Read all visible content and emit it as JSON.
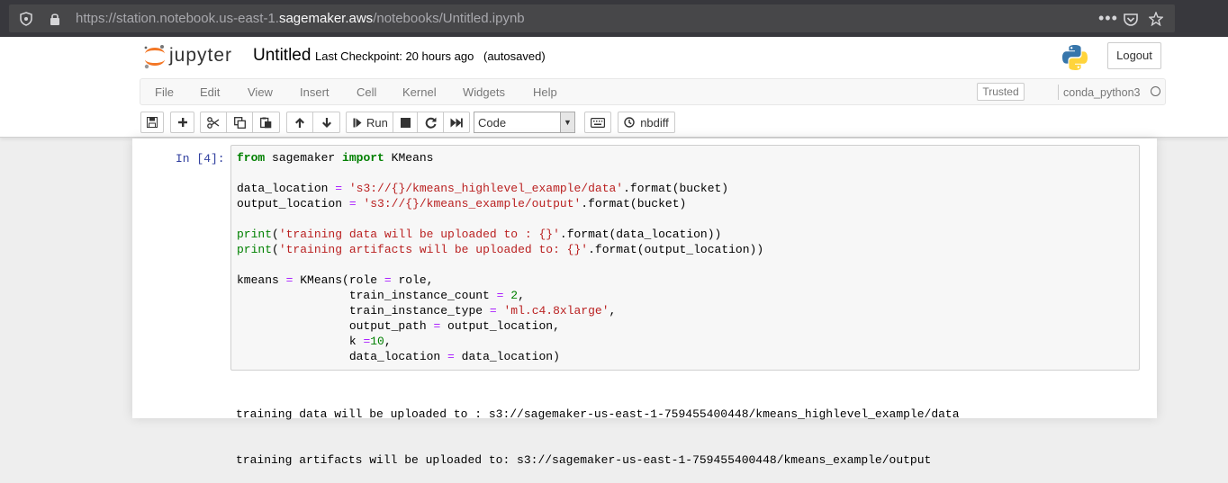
{
  "browser": {
    "url_prefix": "https://station.notebook.us-east-1.",
    "url_domain": "sagemaker.aws",
    "url_path": "/notebooks/Untitled.ipynb",
    "icons": [
      "shield-icon",
      "lock-icon",
      "more-icon",
      "pocket-icon",
      "star-icon"
    ]
  },
  "header": {
    "logo_text": "jupyter",
    "notebook_title": "Untitled",
    "checkpoint": "Last Checkpoint: 20 hours ago",
    "autosave": "(autosaved)",
    "logout_label": "Logout"
  },
  "menu": {
    "items": [
      "File",
      "Edit",
      "View",
      "Insert",
      "Cell",
      "Kernel",
      "Widgets",
      "Help"
    ],
    "trusted": "Trusted",
    "kernel": "conda_python3"
  },
  "toolbar": {
    "run_label": "Run",
    "cell_type": "Code",
    "nbdiff_label": "nbdiff"
  },
  "cell": {
    "prompt": "In [4]:",
    "code_lines": [
      [
        [
          "kw",
          "from"
        ],
        [
          "",
          " sagemaker "
        ],
        [
          "kw",
          "import"
        ],
        [
          "",
          " KMeans"
        ]
      ],
      [],
      [
        [
          "",
          "data_location "
        ],
        [
          "op",
          "="
        ],
        [
          "",
          " "
        ],
        [
          "str",
          "'s3://{}/kmeans_highlevel_example/data'"
        ],
        [
          "",
          ".format(bucket)"
        ]
      ],
      [
        [
          "",
          "output_location "
        ],
        [
          "op",
          "="
        ],
        [
          "",
          " "
        ],
        [
          "str",
          "'s3://{}/kmeans_example/output'"
        ],
        [
          "",
          ".format(bucket)"
        ]
      ],
      [],
      [
        [
          "bi",
          "print"
        ],
        [
          "",
          "("
        ],
        [
          "str",
          "'training data will be uploaded to : {}'"
        ],
        [
          "",
          ".format(data_location))"
        ]
      ],
      [
        [
          "bi",
          "print"
        ],
        [
          "",
          "("
        ],
        [
          "str",
          "'training artifacts will be uploaded to: {}'"
        ],
        [
          "",
          ".format(output_location))"
        ]
      ],
      [],
      [
        [
          "",
          "kmeans "
        ],
        [
          "op",
          "="
        ],
        [
          "",
          " KMeans(role "
        ],
        [
          "op",
          "="
        ],
        [
          "",
          " role,"
        ]
      ],
      [
        [
          "",
          "                train_instance_count "
        ],
        [
          "op",
          "="
        ],
        [
          "",
          " "
        ],
        [
          "num",
          "2"
        ],
        [
          "",
          ","
        ]
      ],
      [
        [
          "",
          "                train_instance_type "
        ],
        [
          "op",
          "="
        ],
        [
          "",
          " "
        ],
        [
          "str",
          "'ml.c4.8xlarge'"
        ],
        [
          "",
          ","
        ]
      ],
      [
        [
          "",
          "                output_path "
        ],
        [
          "op",
          "="
        ],
        [
          "",
          " output_location,"
        ]
      ],
      [
        [
          "",
          "                k "
        ],
        [
          "op",
          "="
        ],
        [
          "num",
          "10"
        ],
        [
          "",
          ","
        ]
      ],
      [
        [
          "",
          "                data_location "
        ],
        [
          "op",
          "="
        ],
        [
          "",
          " data_location)"
        ]
      ]
    ],
    "output_lines": [
      "training data will be uploaded to : s3://sagemaker-us-east-1-759455400448/kmeans_highlevel_example/data",
      "training artifacts will be uploaded to: s3://sagemaker-us-east-1-759455400448/kmeans_example/output"
    ]
  }
}
